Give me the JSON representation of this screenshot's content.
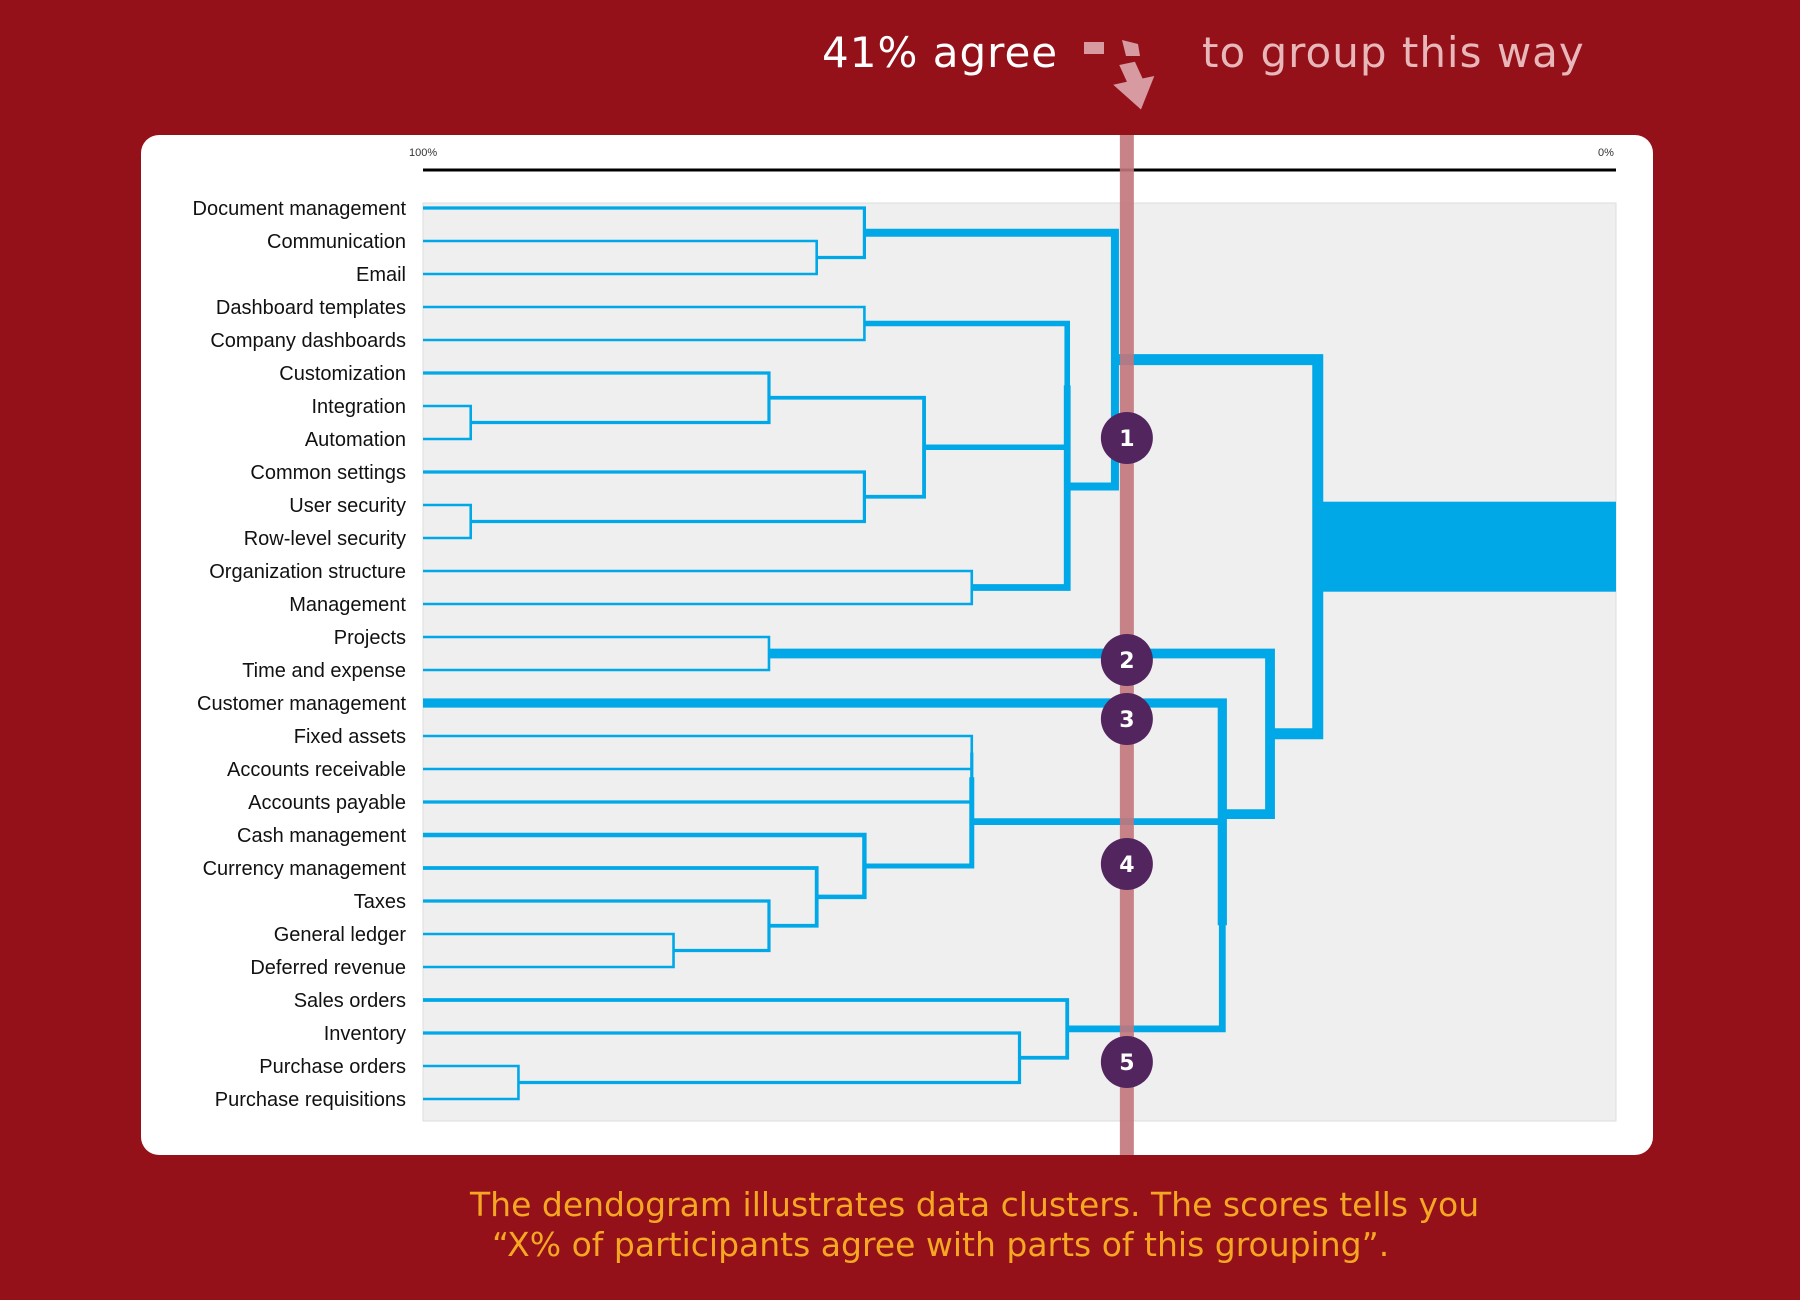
{
  "headline": {
    "agree_text": "41% agree",
    "rest_text": "to group this way",
    "arrow_icon": "curved-arrow-down-icon"
  },
  "chart_data": {
    "type": "dendrogram",
    "axis": {
      "left_label": "100%",
      "right_label": "0%"
    },
    "cutoff_agreement_percent": 41,
    "leaves": [
      "Document management",
      "Communication",
      "Email",
      "Dashboard templates",
      "Company dashboards",
      "Customization",
      "Integration",
      "Automation",
      "Common settings",
      "User security",
      "Row-level security",
      "Organization structure",
      "Management",
      "Projects",
      "Time and expense",
      "Customer management",
      "Fixed assets",
      "Accounts receivable",
      "Accounts payable",
      "Cash management",
      "Currency management",
      "Taxes",
      "General ledger",
      "Deferred revenue",
      "Sales orders",
      "Inventory",
      "Purchase orders",
      "Purchase requisitions"
    ],
    "merges": [
      {
        "a": "L6",
        "b": "L7",
        "agreement": 96
      },
      {
        "a": "L9",
        "b": "L10",
        "agreement": 96
      },
      {
        "a": "L26",
        "b": "L27",
        "agreement": 92
      },
      {
        "a": "L22",
        "b": "L23",
        "agreement": 79
      },
      {
        "a": "L5",
        "b": "M0",
        "agreement": 71
      },
      {
        "a": "L13",
        "b": "L14",
        "agreement": 71
      },
      {
        "a": "L21",
        "b": "M3",
        "agreement": 71
      },
      {
        "a": "L1",
        "b": "L2",
        "agreement": 67
      },
      {
        "a": "L20",
        "b": "M6",
        "agreement": 67
      },
      {
        "a": "L0",
        "b": "M7",
        "agreement": 63
      },
      {
        "a": "L3",
        "b": "L4",
        "agreement": 63
      },
      {
        "a": "L8",
        "b": "M1",
        "agreement": 63
      },
      {
        "a": "L19",
        "b": "M8",
        "agreement": 63
      },
      {
        "a": "M4",
        "b": "M11",
        "agreement": 58
      },
      {
        "a": "L11",
        "b": "L12",
        "agreement": 54
      },
      {
        "a": "L16",
        "b": "L17",
        "agreement": 54
      },
      {
        "a": "M15",
        "b": "L18",
        "agreement": 54
      },
      {
        "a": "M16",
        "b": "M12",
        "agreement": 54
      },
      {
        "a": "L25",
        "b": "M2",
        "agreement": 50
      },
      {
        "a": "M10",
        "b": "M13",
        "agreement": 46
      },
      {
        "a": "M19",
        "b": "M14",
        "agreement": 46
      },
      {
        "a": "L24",
        "b": "M18",
        "agreement": 46
      },
      {
        "a": "M9",
        "b": "M20",
        "agreement": 42
      },
      {
        "a": "M21",
        "b": "M17",
        "agreement": 33
      },
      {
        "a": "L15",
        "b": "M23",
        "agreement": 33
      },
      {
        "a": "M5",
        "b": "M24",
        "agreement": 29
      },
      {
        "a": "M22",
        "b": "M25",
        "agreement": 25
      }
    ],
    "clusters": [
      {
        "label": "1",
        "leaves": [
          "Document management",
          "Communication",
          "Email",
          "Dashboard templates",
          "Company dashboards",
          "Customization",
          "Integration",
          "Automation",
          "Common settings",
          "User security",
          "Row-level security",
          "Organization structure",
          "Management"
        ]
      },
      {
        "label": "2",
        "leaves": [
          "Projects",
          "Time and expense"
        ]
      },
      {
        "label": "3",
        "leaves": [
          "Customer management"
        ]
      },
      {
        "label": "4",
        "leaves": [
          "Fixed assets",
          "Accounts receivable",
          "Accounts payable",
          "Cash management",
          "Currency management",
          "Taxes",
          "General ledger",
          "Deferred revenue"
        ]
      },
      {
        "label": "5",
        "leaves": [
          "Sales orders",
          "Inventory",
          "Purchase orders",
          "Purchase requisitions"
        ]
      }
    ],
    "colors": {
      "background": "#941119",
      "branch": "#00a8e8",
      "cutoff_line": "#c2757b",
      "badge": "#53255f",
      "plot_bg": "#efefef",
      "caption": "#f5a623"
    }
  },
  "caption": {
    "line1": "The dendogram illustrates data clusters. The scores tells you",
    "line2": "“X% of participants agree with parts of this grouping”."
  }
}
